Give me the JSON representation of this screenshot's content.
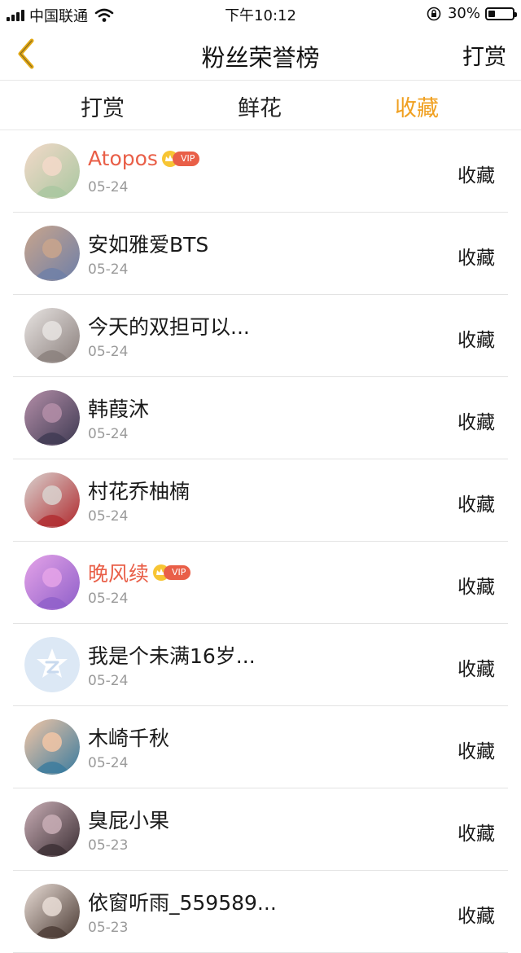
{
  "status_bar": {
    "carrier": "中国联通",
    "time": "下午10:12",
    "battery": "30%",
    "battery_level": 0.3
  },
  "nav": {
    "title": "粉丝荣誉榜",
    "right_label": "打赏",
    "back_icon": "chevron-left-icon",
    "accent": "#f0a020"
  },
  "tabs": [
    {
      "label": "打赏",
      "active": false
    },
    {
      "label": "鲜花",
      "active": false
    },
    {
      "label": "收藏",
      "active": true
    }
  ],
  "vip_label": "VIP",
  "vip_color": "#e95f48",
  "rows": [
    {
      "name": "Atopos",
      "date": "05-24",
      "action": "收藏",
      "vip": true,
      "avatar_colors": [
        "#f3d9c9",
        "#a9c7a0"
      ]
    },
    {
      "name": "安如雅爱BTS",
      "date": "05-24",
      "action": "收藏",
      "vip": false,
      "avatar_colors": [
        "#c9a58c",
        "#6e7fa8"
      ]
    },
    {
      "name": "今天的双担可以...",
      "date": "05-24",
      "action": "收藏",
      "vip": false,
      "avatar_colors": [
        "#e8e4e2",
        "#8a7f7c"
      ]
    },
    {
      "name": "韩葭沐",
      "date": "05-24",
      "action": "收藏",
      "vip": false,
      "avatar_colors": [
        "#b48ea8",
        "#3e3a52"
      ]
    },
    {
      "name": "村花乔柚楠",
      "date": "05-24",
      "action": "收藏",
      "vip": false,
      "avatar_colors": [
        "#d9d2cf",
        "#b02a2e"
      ]
    },
    {
      "name": "晚风续",
      "date": "05-24",
      "action": "收藏",
      "vip": true,
      "avatar_colors": [
        "#e5a3e8",
        "#8e5fc9"
      ]
    },
    {
      "name": "我是个未满16岁...",
      "date": "05-24",
      "action": "收藏",
      "vip": false,
      "avatar_colors": [
        "#dce8f5",
        "#ffffff"
      ]
    },
    {
      "name": "木崎千秋",
      "date": "05-24",
      "action": "收藏",
      "vip": false,
      "avatar_colors": [
        "#f2c6a6",
        "#3a7b9e"
      ]
    },
    {
      "name": "臭屁小果",
      "date": "05-23",
      "action": "收藏",
      "vip": false,
      "avatar_colors": [
        "#c9aeb6",
        "#3b2e33"
      ]
    },
    {
      "name": "依窗听雨_559589...",
      "date": "05-23",
      "action": "收藏",
      "vip": false,
      "avatar_colors": [
        "#e9ddd6",
        "#4a3a33"
      ]
    }
  ]
}
